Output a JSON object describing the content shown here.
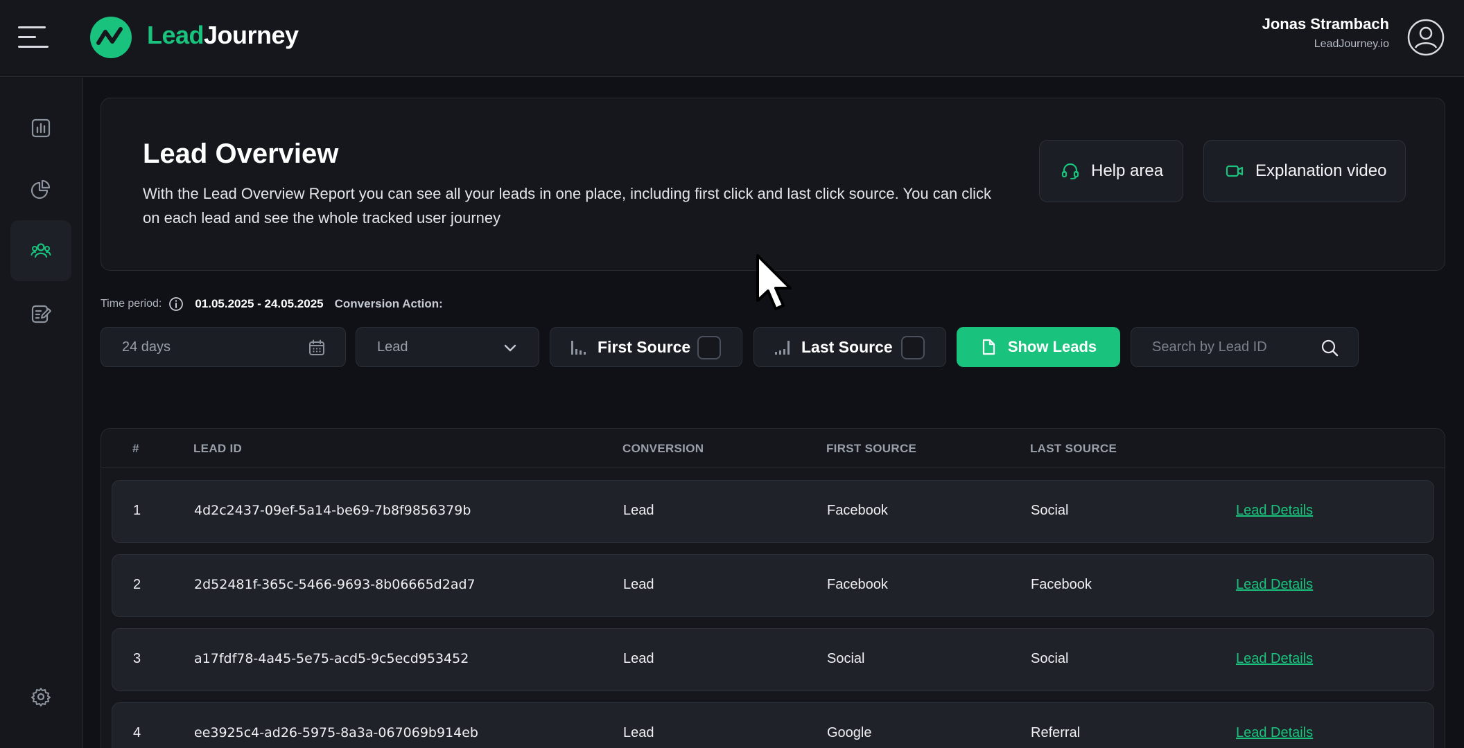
{
  "app": {
    "logo_part1": "Lead",
    "logo_part2": "Journey",
    "brand_color": "#19c37d"
  },
  "user": {
    "name": "Jonas Strambach",
    "org": "LeadJourney.io"
  },
  "sidebar": {
    "items": [
      {
        "icon": "bar-chart-icon",
        "active": false
      },
      {
        "icon": "pie-chart-icon",
        "active": false
      },
      {
        "icon": "users-icon",
        "active": true
      },
      {
        "icon": "edit-document-icon",
        "active": false
      },
      {
        "icon": "gear-icon",
        "active": false
      }
    ]
  },
  "header": {
    "title": "Lead Overview",
    "description": "With the Lead Overview Report you can see all your leads in one place, including first click and last click source. You can click on each lead and see the whole tracked user journey",
    "help_label": "Help area",
    "video_label": "Explanation video"
  },
  "filters": {
    "time_period_label": "Time period:",
    "date_range": "01.05.2025 - 24.05.2025",
    "conversion_action_label": "Conversion Action:",
    "days_value": "24 days",
    "conversion_value": "Lead",
    "first_source_label": "First Source",
    "last_source_label": "Last Source",
    "show_leads_label": "Show Leads",
    "search_placeholder": "Search by Lead ID"
  },
  "table": {
    "columns": [
      "#",
      "LEAD ID",
      "CONVERSION",
      "FIRST SOURCE",
      "LAST SOURCE"
    ],
    "details_label": "Lead Details",
    "rows": [
      {
        "num": "1",
        "lead_id": "4d2c2437-09ef-5a14-be69-7b8f9856379b",
        "conversion": "Lead",
        "first_source": "Facebook",
        "last_source": "Social"
      },
      {
        "num": "2",
        "lead_id": "2d52481f-365c-5466-9693-8b06665d2ad7",
        "conversion": "Lead",
        "first_source": "Facebook",
        "last_source": "Facebook"
      },
      {
        "num": "3",
        "lead_id": "a17fdf78-4a45-5e75-acd5-9c5ecd953452",
        "conversion": "Lead",
        "first_source": "Social",
        "last_source": "Social"
      },
      {
        "num": "4",
        "lead_id": "ee3925c4-ad26-5975-8a3a-067069b914eb",
        "conversion": "Lead",
        "first_source": "Google",
        "last_source": "Referral"
      }
    ]
  }
}
